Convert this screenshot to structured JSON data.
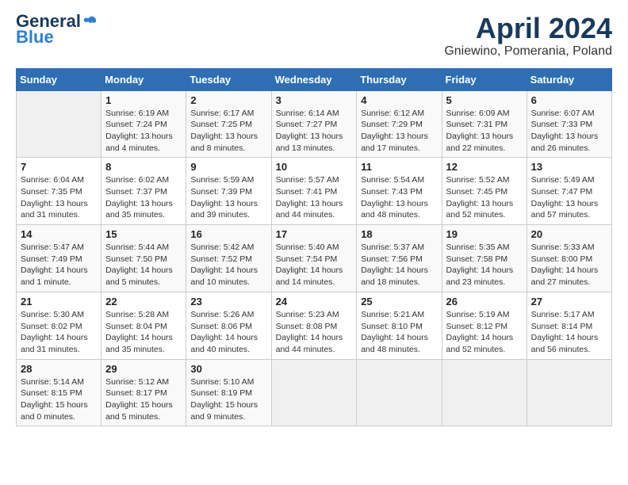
{
  "header": {
    "logo_general": "General",
    "logo_blue": "Blue",
    "title": "April 2024",
    "subtitle": "Gniewino, Pomerania, Poland"
  },
  "weekdays": [
    "Sunday",
    "Monday",
    "Tuesday",
    "Wednesday",
    "Thursday",
    "Friday",
    "Saturday"
  ],
  "weeks": [
    [
      {
        "day": "",
        "info": ""
      },
      {
        "day": "1",
        "info": "Sunrise: 6:19 AM\nSunset: 7:24 PM\nDaylight: 13 hours\nand 4 minutes."
      },
      {
        "day": "2",
        "info": "Sunrise: 6:17 AM\nSunset: 7:25 PM\nDaylight: 13 hours\nand 8 minutes."
      },
      {
        "day": "3",
        "info": "Sunrise: 6:14 AM\nSunset: 7:27 PM\nDaylight: 13 hours\nand 13 minutes."
      },
      {
        "day": "4",
        "info": "Sunrise: 6:12 AM\nSunset: 7:29 PM\nDaylight: 13 hours\nand 17 minutes."
      },
      {
        "day": "5",
        "info": "Sunrise: 6:09 AM\nSunset: 7:31 PM\nDaylight: 13 hours\nand 22 minutes."
      },
      {
        "day": "6",
        "info": "Sunrise: 6:07 AM\nSunset: 7:33 PM\nDaylight: 13 hours\nand 26 minutes."
      }
    ],
    [
      {
        "day": "7",
        "info": "Sunrise: 6:04 AM\nSunset: 7:35 PM\nDaylight: 13 hours\nand 31 minutes."
      },
      {
        "day": "8",
        "info": "Sunrise: 6:02 AM\nSunset: 7:37 PM\nDaylight: 13 hours\nand 35 minutes."
      },
      {
        "day": "9",
        "info": "Sunrise: 5:59 AM\nSunset: 7:39 PM\nDaylight: 13 hours\nand 39 minutes."
      },
      {
        "day": "10",
        "info": "Sunrise: 5:57 AM\nSunset: 7:41 PM\nDaylight: 13 hours\nand 44 minutes."
      },
      {
        "day": "11",
        "info": "Sunrise: 5:54 AM\nSunset: 7:43 PM\nDaylight: 13 hours\nand 48 minutes."
      },
      {
        "day": "12",
        "info": "Sunrise: 5:52 AM\nSunset: 7:45 PM\nDaylight: 13 hours\nand 52 minutes."
      },
      {
        "day": "13",
        "info": "Sunrise: 5:49 AM\nSunset: 7:47 PM\nDaylight: 13 hours\nand 57 minutes."
      }
    ],
    [
      {
        "day": "14",
        "info": "Sunrise: 5:47 AM\nSunset: 7:49 PM\nDaylight: 14 hours\nand 1 minute."
      },
      {
        "day": "15",
        "info": "Sunrise: 5:44 AM\nSunset: 7:50 PM\nDaylight: 14 hours\nand 5 minutes."
      },
      {
        "day": "16",
        "info": "Sunrise: 5:42 AM\nSunset: 7:52 PM\nDaylight: 14 hours\nand 10 minutes."
      },
      {
        "day": "17",
        "info": "Sunrise: 5:40 AM\nSunset: 7:54 PM\nDaylight: 14 hours\nand 14 minutes."
      },
      {
        "day": "18",
        "info": "Sunrise: 5:37 AM\nSunset: 7:56 PM\nDaylight: 14 hours\nand 18 minutes."
      },
      {
        "day": "19",
        "info": "Sunrise: 5:35 AM\nSunset: 7:58 PM\nDaylight: 14 hours\nand 23 minutes."
      },
      {
        "day": "20",
        "info": "Sunrise: 5:33 AM\nSunset: 8:00 PM\nDaylight: 14 hours\nand 27 minutes."
      }
    ],
    [
      {
        "day": "21",
        "info": "Sunrise: 5:30 AM\nSunset: 8:02 PM\nDaylight: 14 hours\nand 31 minutes."
      },
      {
        "day": "22",
        "info": "Sunrise: 5:28 AM\nSunset: 8:04 PM\nDaylight: 14 hours\nand 35 minutes."
      },
      {
        "day": "23",
        "info": "Sunrise: 5:26 AM\nSunset: 8:06 PM\nDaylight: 14 hours\nand 40 minutes."
      },
      {
        "day": "24",
        "info": "Sunrise: 5:23 AM\nSunset: 8:08 PM\nDaylight: 14 hours\nand 44 minutes."
      },
      {
        "day": "25",
        "info": "Sunrise: 5:21 AM\nSunset: 8:10 PM\nDaylight: 14 hours\nand 48 minutes."
      },
      {
        "day": "26",
        "info": "Sunrise: 5:19 AM\nSunset: 8:12 PM\nDaylight: 14 hours\nand 52 minutes."
      },
      {
        "day": "27",
        "info": "Sunrise: 5:17 AM\nSunset: 8:14 PM\nDaylight: 14 hours\nand 56 minutes."
      }
    ],
    [
      {
        "day": "28",
        "info": "Sunrise: 5:14 AM\nSunset: 8:15 PM\nDaylight: 15 hours\nand 0 minutes."
      },
      {
        "day": "29",
        "info": "Sunrise: 5:12 AM\nSunset: 8:17 PM\nDaylight: 15 hours\nand 5 minutes."
      },
      {
        "day": "30",
        "info": "Sunrise: 5:10 AM\nSunset: 8:19 PM\nDaylight: 15 hours\nand 9 minutes."
      },
      {
        "day": "",
        "info": ""
      },
      {
        "day": "",
        "info": ""
      },
      {
        "day": "",
        "info": ""
      },
      {
        "day": "",
        "info": ""
      }
    ]
  ]
}
